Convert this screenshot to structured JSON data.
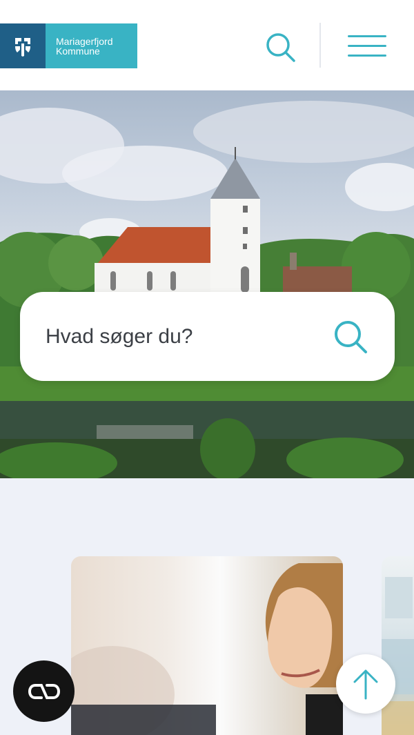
{
  "header": {
    "logo": {
      "line1": "Mariagerfjord",
      "line2": "Kommune",
      "icon": "municipality-crest-icon",
      "mark_color": "#1f5f87",
      "brand_color": "#39b3c4"
    },
    "search_icon": "search-icon",
    "menu_icon": "hamburger-menu-icon"
  },
  "hero": {
    "image": "church-landscape-photo",
    "search": {
      "placeholder": "Hvad søger du?",
      "icon": "search-icon"
    }
  },
  "cards": [
    {
      "image": "woman-smiling-photo"
    },
    {
      "image": "office-interior-photo"
    }
  ],
  "floating": {
    "cookie_icon": "cookie-consent-icon",
    "scroll_top_icon": "arrow-up-icon"
  },
  "colors": {
    "accent": "#39b3c4",
    "background": "#eef1f8",
    "cookie_button": "#141414"
  }
}
